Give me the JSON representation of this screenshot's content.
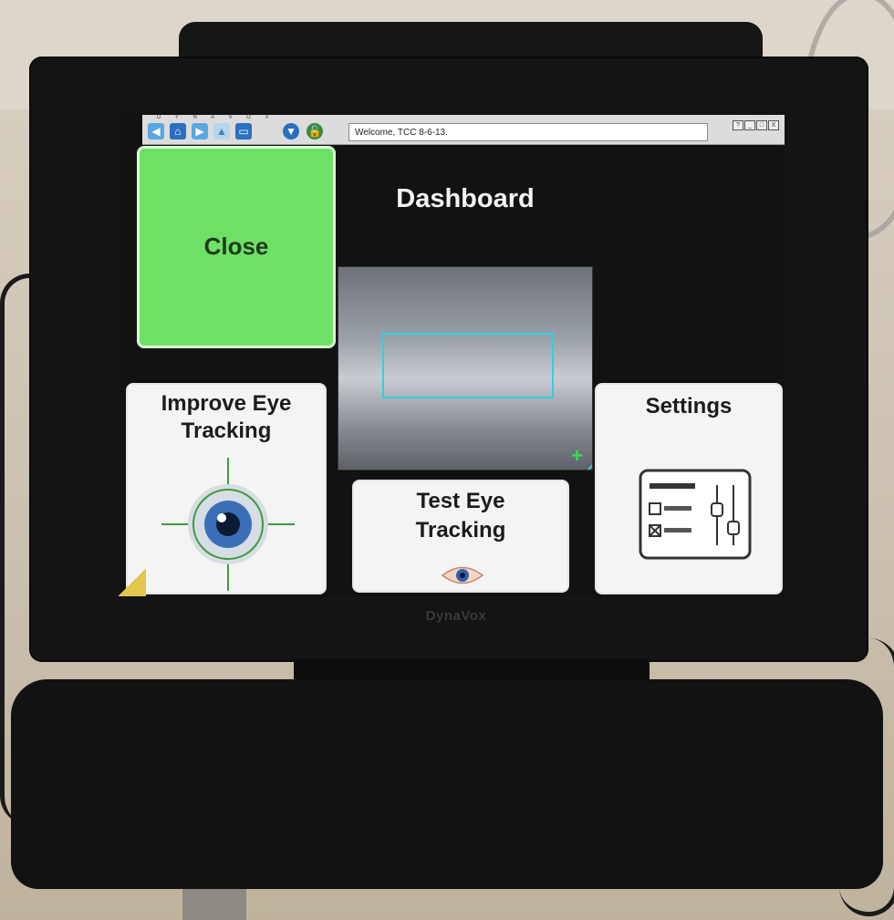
{
  "toolbar": {
    "letters": "D Y N A V O X",
    "welcome_text": "Welcome, TCC 8-6-13.",
    "buttons": [
      "back-icon",
      "home-icon",
      "forward-icon",
      "up-icon",
      "page-icon",
      "dropdown-icon",
      "lock-icon"
    ],
    "window_controls": [
      "?",
      "_",
      "□",
      "X"
    ]
  },
  "screen": {
    "title": "Dashboard",
    "tiles": {
      "close": "Close",
      "improve_line1": "Improve Eye",
      "improve_line2": "Tracking",
      "test_line1": "Test Eye",
      "test_line2": "Tracking",
      "settings": "Settings"
    }
  },
  "device": {
    "brand": "DynaVox"
  },
  "colors": {
    "close_tile": "#6fe066",
    "tracking_box": "#2ed1e6",
    "focus_plus": "#2fe04a",
    "screen_bg": "#131212"
  }
}
